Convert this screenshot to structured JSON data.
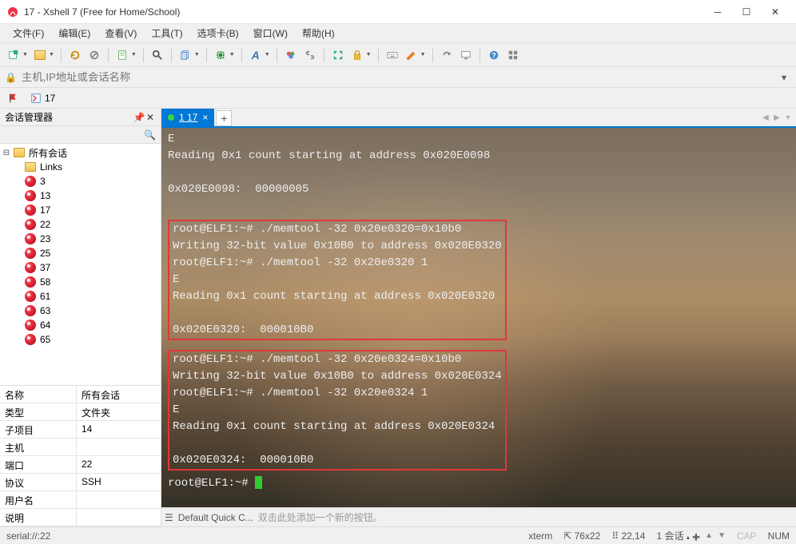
{
  "window": {
    "title": "17 - Xshell 7 (Free for Home/School)"
  },
  "menu": [
    "文件(F)",
    "编辑(E)",
    "查看(V)",
    "工具(T)",
    "选项卡(B)",
    "窗口(W)",
    "帮助(H)"
  ],
  "addressbar": {
    "placeholder": "主机,IP地址或会话名称"
  },
  "bookmarks": {
    "label": "17"
  },
  "sidebar": {
    "title": "会话管理器",
    "root": "所有会话",
    "links": "Links",
    "items": [
      "3",
      "13",
      "17",
      "22",
      "23",
      "25",
      "37",
      "58",
      "61",
      "63",
      "64",
      "65"
    ]
  },
  "props": {
    "rows": [
      {
        "k": "名称",
        "v": "所有会话"
      },
      {
        "k": "类型",
        "v": "文件夹"
      },
      {
        "k": "子项目",
        "v": "14"
      },
      {
        "k": "主机",
        "v": ""
      },
      {
        "k": "端口",
        "v": "22"
      },
      {
        "k": "协议",
        "v": "SSH"
      },
      {
        "k": "用户名",
        "v": ""
      },
      {
        "k": "说明",
        "v": ""
      }
    ]
  },
  "tab": {
    "label": "1 17"
  },
  "terminal": {
    "pre": [
      "E",
      "Reading 0x1 count starting at address 0x020E0098",
      "",
      "0x020E0098:  00000005",
      ""
    ],
    "box1": [
      "root@ELF1:~# ./memtool -32 0x20e0320=0x10b0",
      "Writing 32-bit value 0x10B0 to address 0x020E0320",
      "root@ELF1:~# ./memtool -32 0x20e0320 1",
      "E",
      "Reading 0x1 count starting at address 0x020E0320",
      "",
      "0x020E0320:  000010B0"
    ],
    "box2": [
      "root@ELF1:~# ./memtool -32 0x20e0324=0x10b0",
      "Writing 32-bit value 0x10B0 to address 0x020E0324",
      "root@ELF1:~# ./memtool -32 0x20e0324 1",
      "E",
      "Reading 0x1 count starting at address 0x020E0324",
      "",
      "0x020E0324:  000010B0"
    ],
    "prompt": "root@ELF1:~# "
  },
  "quickcmd": {
    "label": "Default Quick C...",
    "hint": "双击此处添加一个新的按钮。"
  },
  "statusbar": {
    "left": "serial://:22",
    "term": "xterm",
    "size": "76x22",
    "pos": "22,14",
    "sessions": "1 会话",
    "cap": "CAP",
    "num": "NUM"
  }
}
